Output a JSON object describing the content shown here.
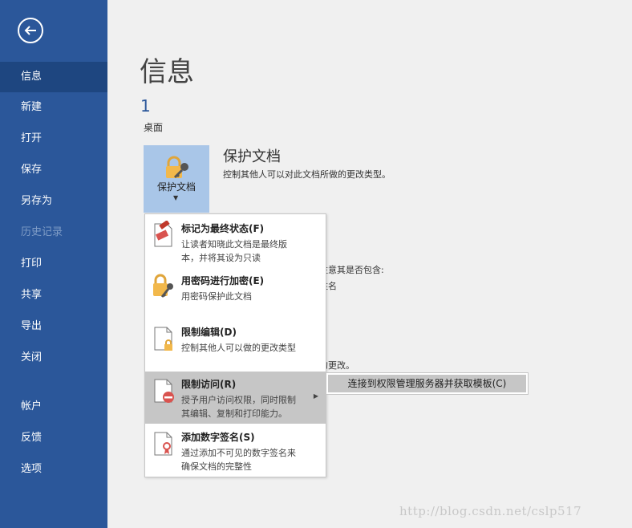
{
  "sidebar": {
    "back_icon": "arrow-left-icon",
    "items": [
      {
        "label": "信息",
        "state": "active"
      },
      {
        "label": "新建",
        "state": "normal"
      },
      {
        "label": "打开",
        "state": "normal"
      },
      {
        "label": "保存",
        "state": "normal"
      },
      {
        "label": "另存为",
        "state": "normal"
      },
      {
        "label": "历史记录",
        "state": "disabled"
      },
      {
        "label": "打印",
        "state": "normal"
      },
      {
        "label": "共享",
        "state": "normal"
      },
      {
        "label": "导出",
        "state": "normal"
      },
      {
        "label": "关闭",
        "state": "normal"
      },
      {
        "label": "帐户",
        "state": "normal"
      },
      {
        "label": "反馈",
        "state": "normal"
      },
      {
        "label": "选项",
        "state": "normal"
      }
    ],
    "colors": {
      "background": "#2b579a",
      "active": "#1e4680"
    }
  },
  "main": {
    "title": "信息",
    "doc_name": "1",
    "doc_location": "桌面",
    "protect": {
      "button_label": "保护文档",
      "title": "保护文档",
      "desc": "控制其他人可以对此文档所做的更改类型。"
    },
    "background_fragments": {
      "inspect": "注意其是否包含:",
      "author": "姓名",
      "changes": "的更改。"
    }
  },
  "menu": {
    "items": [
      {
        "title": "标记为最终状态(F)",
        "desc_line1": "让读者知晓此文档是最终版",
        "desc_line2": "本，并将其设为只读",
        "icon": "final-stamp-icon"
      },
      {
        "title": "用密码进行加密(E)",
        "desc_line1": "用密码保护此文档",
        "icon": "lock-key-icon"
      },
      {
        "title": "限制编辑(D)",
        "desc_line1": "控制其他人可以做的更改类型",
        "icon": "restrict-editing-icon"
      },
      {
        "title": "限制访问(R)",
        "desc_line1": "授予用户访问权限，同时限制",
        "desc_line2": "其编辑、复制和打印能力。",
        "icon": "restrict-access-icon"
      },
      {
        "title": "添加数字签名(S)",
        "desc_line1": "通过添加不可见的数字签名来",
        "desc_line2": "确保文档的完整性",
        "icon": "digital-signature-icon"
      }
    ],
    "submenu_item": "连接到权限管理服务器并获取模板(C)"
  },
  "watermark": "http://blog.csdn.net/cslp517"
}
